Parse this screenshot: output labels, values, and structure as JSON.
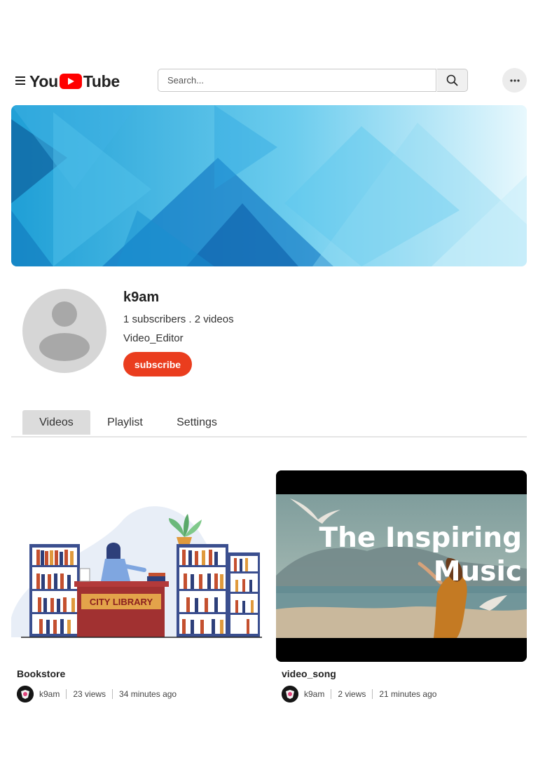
{
  "header": {
    "logo_left": "You",
    "logo_right": "Tube",
    "search_placeholder": "Search..."
  },
  "channel": {
    "name": "k9am",
    "stats": "1 subscribers . 2 videos",
    "role": "Video_Editor",
    "subscribe_label": "subscribe"
  },
  "tabs": [
    {
      "label": "Videos",
      "active": true
    },
    {
      "label": "Playlist",
      "active": false
    },
    {
      "label": "Settings",
      "active": false
    }
  ],
  "videos": [
    {
      "title": "Bookstore",
      "channel": "k9am",
      "views": "23 views",
      "age": "34 minutes ago",
      "thumb_text": "CITY LIBRARY"
    },
    {
      "title": "video_song",
      "channel": "k9am",
      "views": "2 views",
      "age": "21 minutes ago",
      "thumb_line1": "The Inspiring",
      "thumb_line2": "Music"
    }
  ],
  "colors": {
    "subscribe": "#ea3d1e",
    "logo_red": "#ff0000",
    "active_tab": "#dcdcdc"
  }
}
